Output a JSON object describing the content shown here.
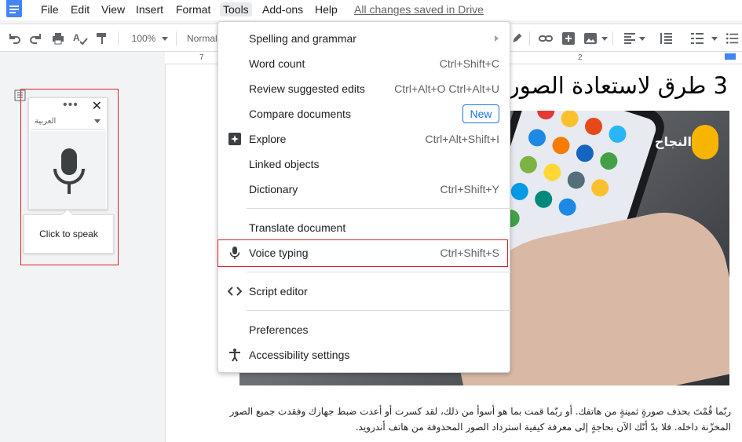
{
  "menubar": {
    "items": [
      "File",
      "Edit",
      "View",
      "Insert",
      "Format",
      "Tools",
      "Add-ons",
      "Help"
    ],
    "active": "Tools",
    "saved_status": "All changes saved in Drive"
  },
  "toolbar": {
    "zoom": "100%",
    "style": "Normal"
  },
  "ruler": {
    "left_num": "7",
    "right_num": "2"
  },
  "tools_menu": {
    "items": [
      {
        "label": "Spelling and grammar",
        "shortcut": "",
        "icon": "",
        "submenu": true
      },
      {
        "label": "Word count",
        "shortcut": "Ctrl+Shift+C",
        "icon": ""
      },
      {
        "label": "Review suggested edits",
        "shortcut": "Ctrl+Alt+O Ctrl+Alt+U",
        "icon": ""
      },
      {
        "label": "Compare documents",
        "shortcut": "",
        "badge": "New",
        "icon": ""
      },
      {
        "label": "Explore",
        "shortcut": "Ctrl+Alt+Shift+I",
        "icon": "explore-icon"
      },
      {
        "label": "Linked objects",
        "shortcut": "",
        "icon": ""
      },
      {
        "label": "Dictionary",
        "shortcut": "Ctrl+Shift+Y",
        "icon": ""
      },
      {
        "label": "Translate document",
        "shortcut": "",
        "icon": ""
      },
      {
        "label": "Voice typing",
        "shortcut": "Ctrl+Shift+S",
        "icon": "microphone-icon",
        "highlighted": true
      },
      {
        "label": "Script editor",
        "shortcut": "",
        "icon": "code-icon"
      },
      {
        "label": "Preferences",
        "shortcut": "",
        "icon": ""
      },
      {
        "label": "Accessibility settings",
        "shortcut": "",
        "icon": "accessibility-icon"
      }
    ]
  },
  "voice_widget": {
    "language": "العربية",
    "tooltip": "Click to speak"
  },
  "document": {
    "title": "3 طرق لاستعادة الصور",
    "paragraph_line1": "ربّما قُمْتَ بحذف صورةٍ ثمينةٍ من هاتفك. أو ربّما قمت بما هو أسوأ من ذلك، لقد كسرت أو أعدت ضبط جهازك وفقدت جميع الصور",
    "paragraph_line2": "المخزّنة داخله. فلا بدّ أنّك الآن بحاجةٍ إلى معرفة كيفية استرداد الصور المحذوفة من هاتف أندرويد.",
    "hero_logo_text": "النجاح"
  },
  "colors": {
    "accent": "#1a73e8",
    "annotation_red": "#d9232c",
    "brand_yellow": "#f7b500"
  }
}
